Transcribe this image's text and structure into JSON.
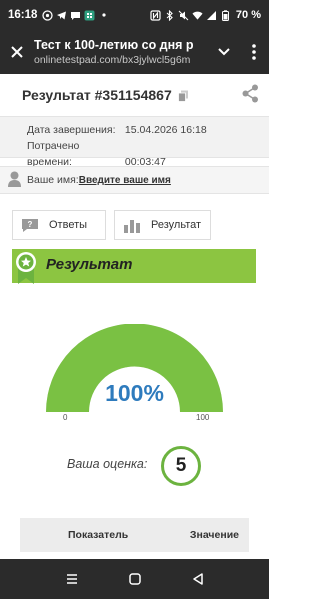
{
  "status": {
    "time": "16:18",
    "battery": "70 %"
  },
  "browser": {
    "title": "Тест к 100-летию со дня р",
    "url": "onlinetestpad.com/bx3jylwcl5g6m"
  },
  "result": {
    "heading": "Результат #351154867",
    "finish_label": "Дата завершения:",
    "finish_value": "15.04.2026 16:18",
    "time_label": "Потрачено времени:",
    "time_value": "00:03:47",
    "name_label": "Ваше имя:",
    "name_link": "Введите ваше имя"
  },
  "buttons": {
    "answers": "Ответы",
    "result": "Результат"
  },
  "banner": {
    "title": "Результат"
  },
  "gauge": {
    "value_percent": 100,
    "label": "100%",
    "min": "0",
    "max": "100"
  },
  "grade": {
    "label": "Ваша оценка:",
    "value": "5"
  },
  "table": {
    "col1": "Показатель",
    "col2": "Значение"
  },
  "colors": {
    "accent_green": "#8cc541",
    "gauge_green": "#7ac143",
    "percent_blue": "#2e7bbd"
  }
}
